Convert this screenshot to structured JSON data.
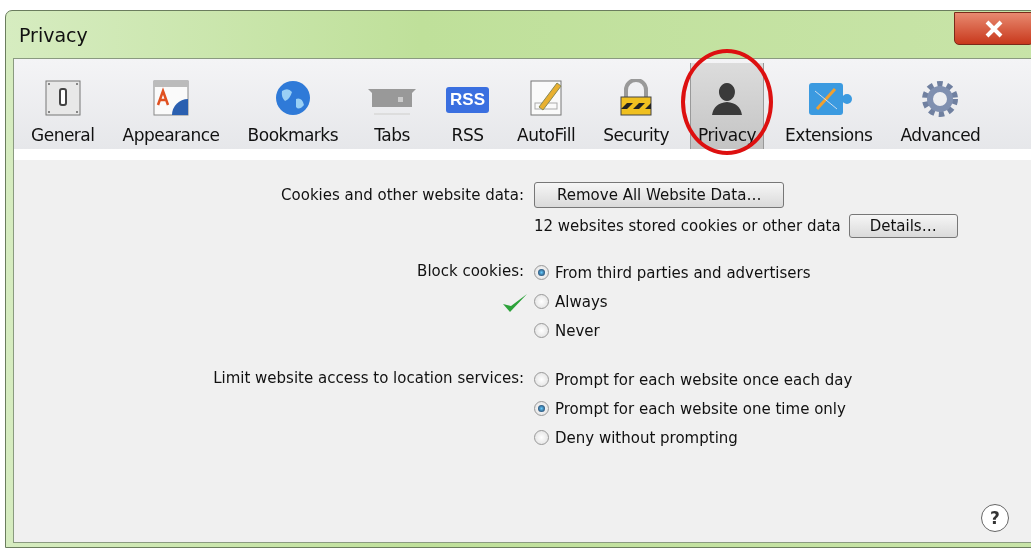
{
  "window": {
    "title": "Privacy"
  },
  "toolbar": {
    "items": [
      {
        "label": "General",
        "selected": false
      },
      {
        "label": "Appearance",
        "selected": false
      },
      {
        "label": "Bookmarks",
        "selected": false
      },
      {
        "label": "Tabs",
        "selected": false
      },
      {
        "label": "RSS",
        "selected": false,
        "icon_text": "RSS"
      },
      {
        "label": "AutoFill",
        "selected": false
      },
      {
        "label": "Security",
        "selected": false
      },
      {
        "label": "Privacy",
        "selected": true,
        "annotated": true
      },
      {
        "label": "Extensions",
        "selected": false
      },
      {
        "label": "Advanced",
        "selected": false
      }
    ]
  },
  "cookies": {
    "label": "Cookies and other website data:",
    "remove_button": "Remove All Website Data…",
    "info": "12 websites stored cookies or other data",
    "details_button": "Details…"
  },
  "block_cookies": {
    "label": "Block cookies:",
    "options": [
      {
        "label": "From third parties and advertisers",
        "selected": true
      },
      {
        "label": "Always",
        "selected": false,
        "annotated": true
      },
      {
        "label": "Never",
        "selected": false
      }
    ]
  },
  "location": {
    "label": "Limit website access to location services:",
    "options": [
      {
        "label": "Prompt for each website once each day",
        "selected": false
      },
      {
        "label": "Prompt for each website one time only",
        "selected": true
      },
      {
        "label": "Deny without prompting",
        "selected": false
      }
    ]
  },
  "help_button": "?"
}
